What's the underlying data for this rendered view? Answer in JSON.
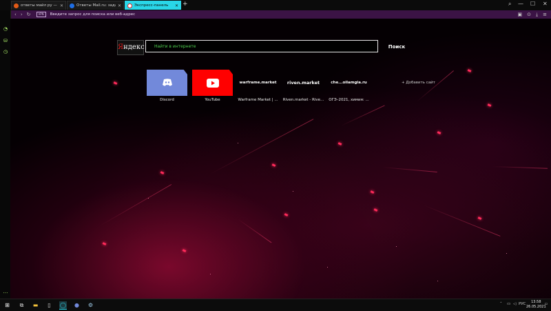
{
  "tabs": [
    {
      "title": "ответы майл ру — Янде...",
      "favicon": "yandex-favicon",
      "color": "#e25a16"
    },
    {
      "title": "Ответы Mail.ru: задать во...",
      "favicon": "mailru-favicon",
      "color": "#1e6ee6"
    },
    {
      "title": "Экспресс-панель",
      "favicon": "opera-favicon",
      "color": "#ffffff"
    }
  ],
  "tab_close": "✕",
  "new_tab": "+",
  "window_controls": {
    "minimize": "—",
    "maximize": "☐",
    "close": "✕"
  },
  "address_bar": {
    "back": "‹",
    "forward": "›",
    "reload": "↻",
    "private_badge": "VPN",
    "placeholder": "Введите запрос для поиска или веб-адрес"
  },
  "search": {
    "logo": "Яндекс",
    "placeholder": "Найти в интернете",
    "button": "Поиск"
  },
  "speed_dial": [
    {
      "label": "Discord",
      "logo": "",
      "bg": "#7289da"
    },
    {
      "label": "YouTube",
      "logo": "",
      "bg": "#ff0000"
    },
    {
      "label": "Warframe Market | ...",
      "logo": "warframe.market",
      "bg": "transparent"
    },
    {
      "label": "Riven.market - Rive...",
      "logo": "riven.market",
      "bg": "transparent"
    },
    {
      "label": "ОГЭ–2021, химия: ...",
      "logo": "che...oilamgia.ru",
      "bg": "transparent"
    }
  ],
  "add_site": "+ Добавить сайт",
  "tray": {
    "lang": "РУС",
    "time": "13:58",
    "date": "26.05.2021"
  },
  "colors": {
    "accent": "#29d6e8",
    "address_bg": "#3b1345",
    "sidebar_icon": "#aef06a"
  }
}
